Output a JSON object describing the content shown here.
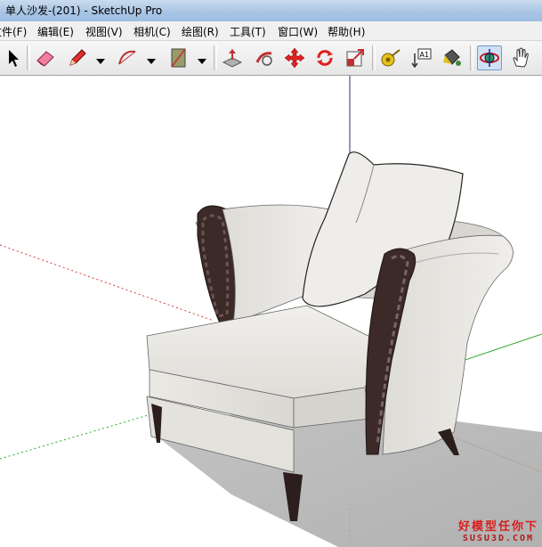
{
  "window": {
    "title": "单人沙发-(201) - SketchUp Pro"
  },
  "menu": {
    "items": [
      "文件(F)",
      "编辑(E)",
      "视图(V)",
      "相机(C)",
      "绘图(R)",
      "工具(T)",
      "窗口(W)",
      "帮助(H)"
    ]
  },
  "toolbar": {
    "tools": [
      "select-icon",
      "eraser-icon",
      "pencil-icon",
      "arc-icon",
      "rectangle-icon",
      "push-pull-icon",
      "follow-me-icon",
      "move-icon",
      "rotate-icon",
      "scale-icon",
      "tape-measure-icon",
      "text-icon",
      "paint-bucket-icon",
      "orbit-icon",
      "pan-icon"
    ],
    "text_tool_label": "A1"
  },
  "viewport": {
    "model": "armchair-model"
  },
  "watermark": {
    "cn": "好模型任你下",
    "en": "SUSU3D.COM"
  },
  "colors": {
    "axis_red": "#d63a3a",
    "axis_green": "#2aa82a",
    "axis_blue": "#3a3ad6",
    "fabric": "#e8e6e1",
    "wood": "#3b2a28"
  }
}
